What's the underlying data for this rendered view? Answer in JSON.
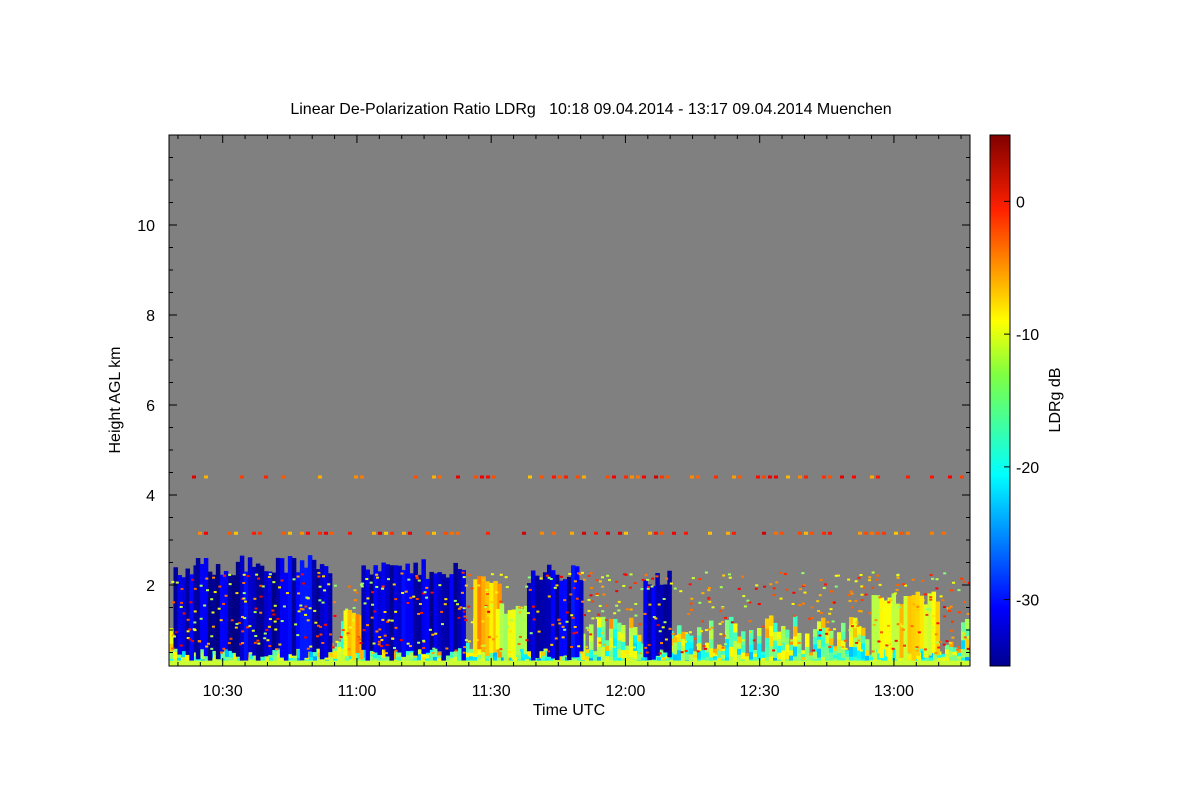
{
  "chart_data": {
    "type": "heatmap",
    "title": "Linear De-Polarization Ratio LDRg   10:18 09.04.2014 - 13:17 09.04.2014 Muenchen",
    "xlabel": "Time UTC",
    "ylabel": "Height AGL km",
    "x_ticks": [
      "10:30",
      "11:00",
      "11:30",
      "12:00",
      "12:30",
      "13:00"
    ],
    "y_ticks": [
      "2",
      "4",
      "6",
      "8",
      "10"
    ],
    "xlim": [
      "10:18",
      "13:17"
    ],
    "ylim": [
      0.2,
      12
    ],
    "colorbar": {
      "label": "LDRg dB",
      "ticks": [
        "0",
        "-10",
        "-20",
        "-30"
      ],
      "range": [
        -35,
        5
      ]
    },
    "background_color": "#808080",
    "grid": false,
    "features": [
      {
        "time_start": "10:19",
        "time_end": "10:24",
        "top_km": 2.4,
        "ldr_db": -32
      },
      {
        "time_start": "10:24",
        "time_end": "10:54",
        "top_km": 2.6,
        "ldr_db": -32
      },
      {
        "time_start": "10:57",
        "time_end": "11:08",
        "top_km": 1.5,
        "ldr_db": -8
      },
      {
        "time_start": "11:01",
        "time_end": "11:24",
        "top_km": 2.5,
        "ldr_db": -32
      },
      {
        "time_start": "11:26",
        "time_end": "11:32",
        "top_km": 2.2,
        "ldr_db": -8
      },
      {
        "time_start": "11:31",
        "time_end": "11:39",
        "top_km": 1.6,
        "ldr_db": -12
      },
      {
        "time_start": "11:38",
        "time_end": "11:50",
        "top_km": 2.4,
        "ldr_db": -32
      },
      {
        "time_start": "12:04",
        "time_end": "12:10",
        "top_km": 2.3,
        "ldr_db": -32
      },
      {
        "time_start": "12:55",
        "time_end": "13:10",
        "top_km": 1.8,
        "ldr_db": -10
      }
    ],
    "aerosol_layer_km": [
      3.15,
      4.4
    ]
  }
}
